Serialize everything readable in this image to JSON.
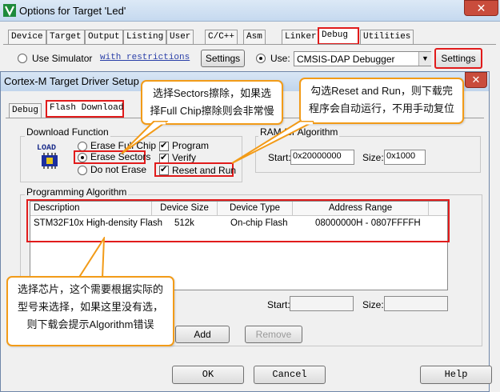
{
  "outer": {
    "title": "Options for Target 'Led'",
    "close_label": "✕",
    "tabs": [
      "Device",
      "Target",
      "Output",
      "Listing",
      "User",
      "C/C++",
      "Asm",
      "Linker",
      "Debug",
      "Utilities"
    ],
    "use_simulator": "Use Simulator",
    "with_restrictions": "with restrictions",
    "settings_left": "Settings",
    "use": "Use:",
    "debugger": "CMSIS-DAP Debugger",
    "settings_right": "Settings"
  },
  "inner": {
    "title": "Cortex-M Target Driver Setup",
    "close_label": "✕",
    "tabs": [
      "Debug",
      "Flash Download"
    ],
    "download_function": {
      "label": "Download Function",
      "logo_text": "LOAD",
      "erase_full": "Erase Full Chip",
      "erase_sectors": "Erase Sectors",
      "no_erase": "Do not Erase",
      "program": "Program",
      "verify": "Verify",
      "reset_run": "Reset and Run"
    },
    "ram": {
      "label": "RAM for Algorithm",
      "start_label": "Start:",
      "start_value": "0x20000000",
      "size_label": "Size:",
      "size_value": "0x1000"
    },
    "algo": {
      "label": "Programming Algorithm",
      "columns": [
        "Description",
        "Device Size",
        "Device Type",
        "Address Range"
      ],
      "row": {
        "description": "STM32F10x High-density Flash",
        "size": "512k",
        "type": "On-chip Flash",
        "range": "08000000H - 0807FFFFH"
      },
      "start_label": "Start:",
      "size_label": "Size:",
      "add": "Add",
      "remove": "Remove"
    },
    "ok": "OK",
    "cancel": "Cancel",
    "help": "Help"
  },
  "callouts": {
    "sectors": [
      "选择Sectors擦除，如果选",
      "择Full Chip擦除则会非常慢"
    ],
    "reset": [
      "勾选Reset and Run，则下载完",
      "程序会自动运行，不用手动复位"
    ],
    "chip": [
      "选择芯片，这个需要根据实际的",
      "型号来选择，如果这里没有选，",
      "则下载会提示Algorithm错误"
    ]
  },
  "colors": {
    "highlight": "#e11b1b",
    "callout_border": "#f29b18",
    "link": "#2a3fa8"
  }
}
